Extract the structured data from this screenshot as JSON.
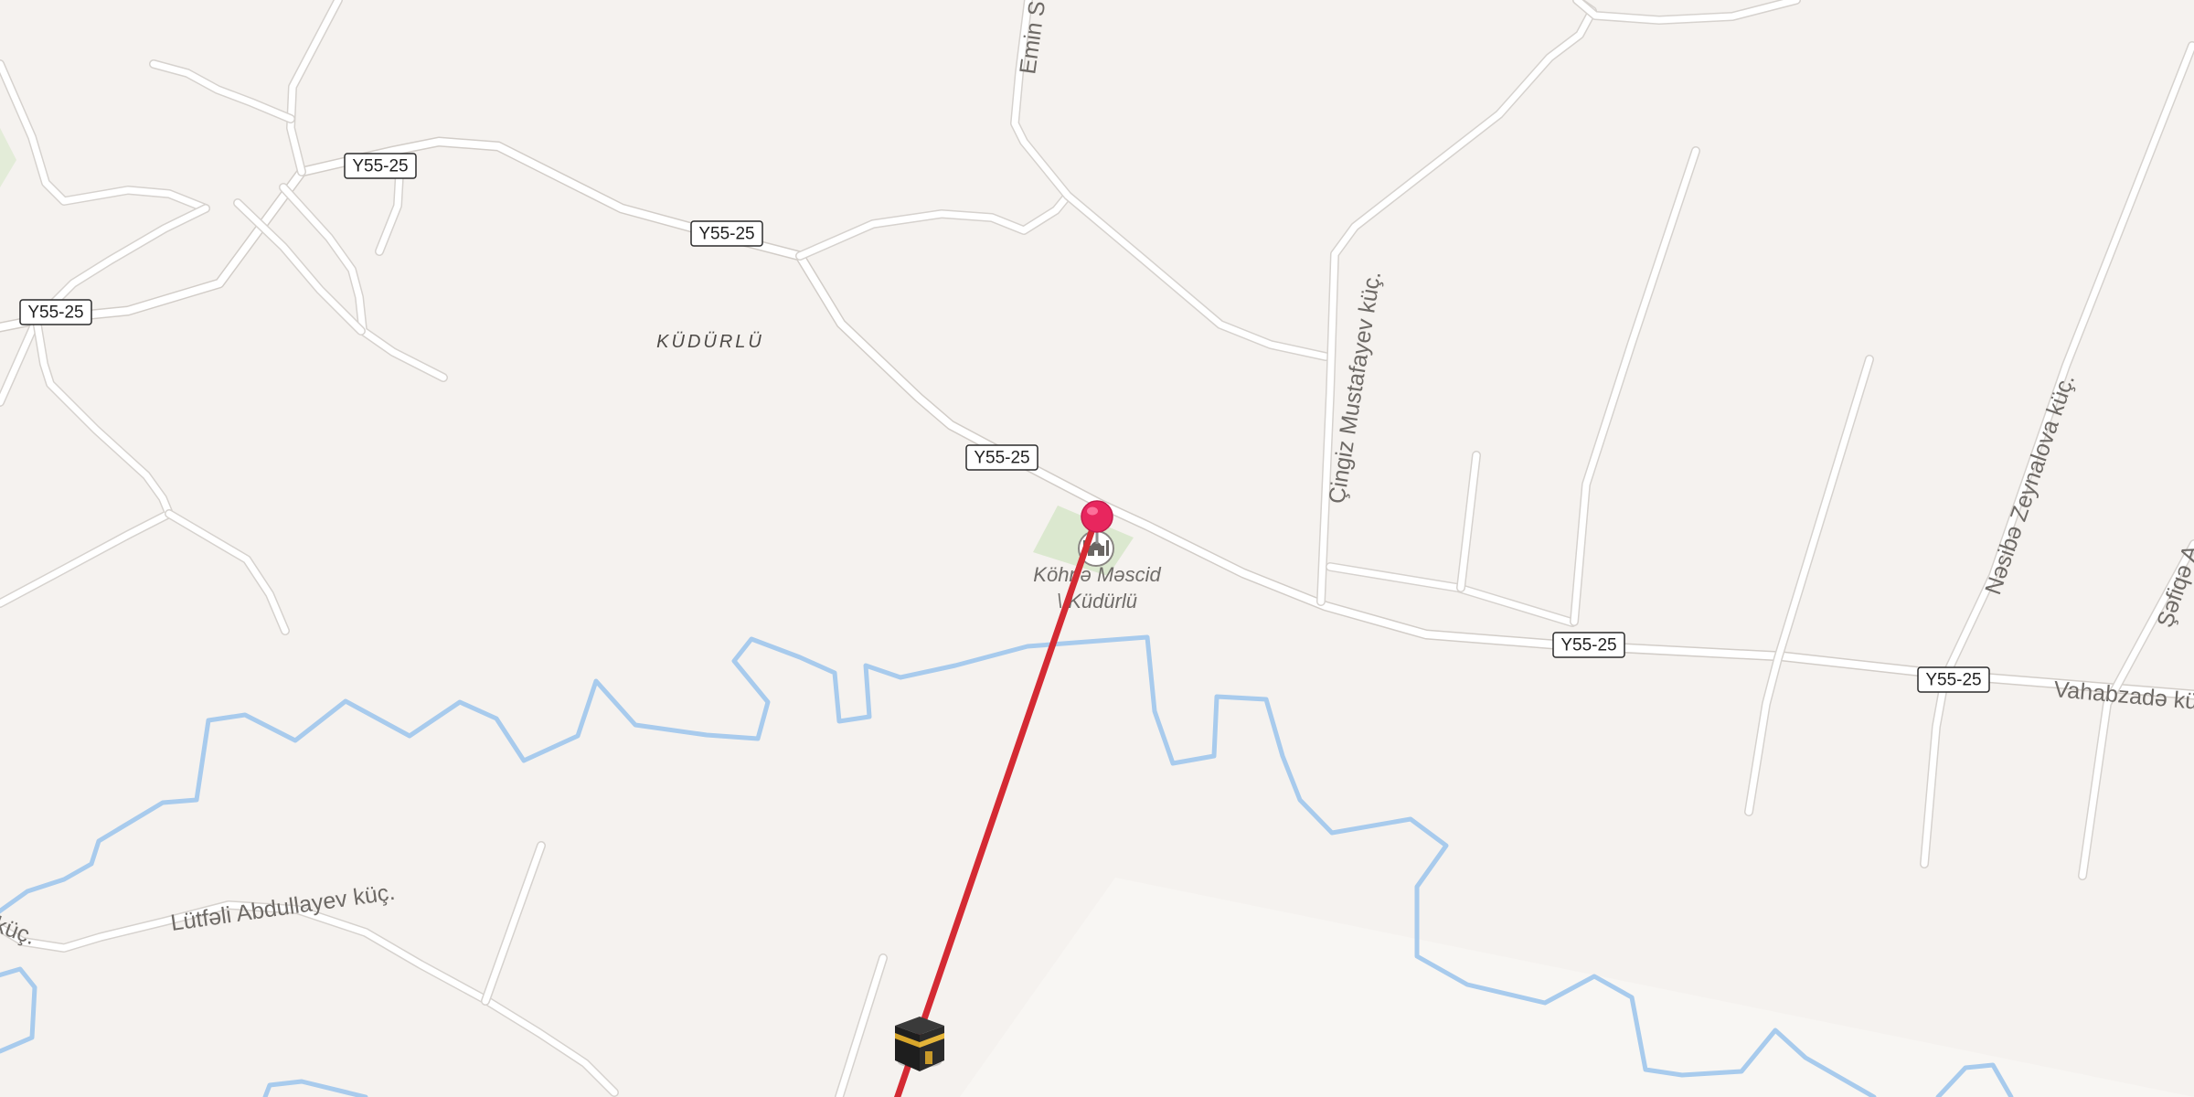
{
  "map": {
    "colors": {
      "land": "#f5f2ef",
      "road": "#ffffff",
      "road_casing": "#d6d2ce",
      "river": "#a8cbed",
      "park": "#dbe8cf",
      "route_line": "#d42a33",
      "pin": "#e8265e"
    },
    "place_labels": {
      "village": "KÜDÜRLÜ"
    },
    "road_shields": [
      "Y55-25",
      "Y55-25",
      "Y55-25",
      "Y55-25",
      "Y55-25",
      "Y55-25"
    ],
    "street_labels": {
      "emin": "Emin S",
      "cingiz": "Çingiz Mustafayev küç.",
      "nasiba": "Nəsibə Zeynalova küç.",
      "safiqa": "Şəfiqə A",
      "vahabzada": "Vahabzadə küç.",
      "lutfali": "Lütfəli Abdullayev küç.",
      "kuc_left": "küç."
    },
    "poi": {
      "name_line1": "Köhnə Məscid",
      "name_line2": "\\ Küdürlü",
      "icon": "mosque-icon"
    },
    "pin": {
      "icon": "map-pin-icon"
    },
    "destination": {
      "icon": "kaaba-icon"
    }
  }
}
